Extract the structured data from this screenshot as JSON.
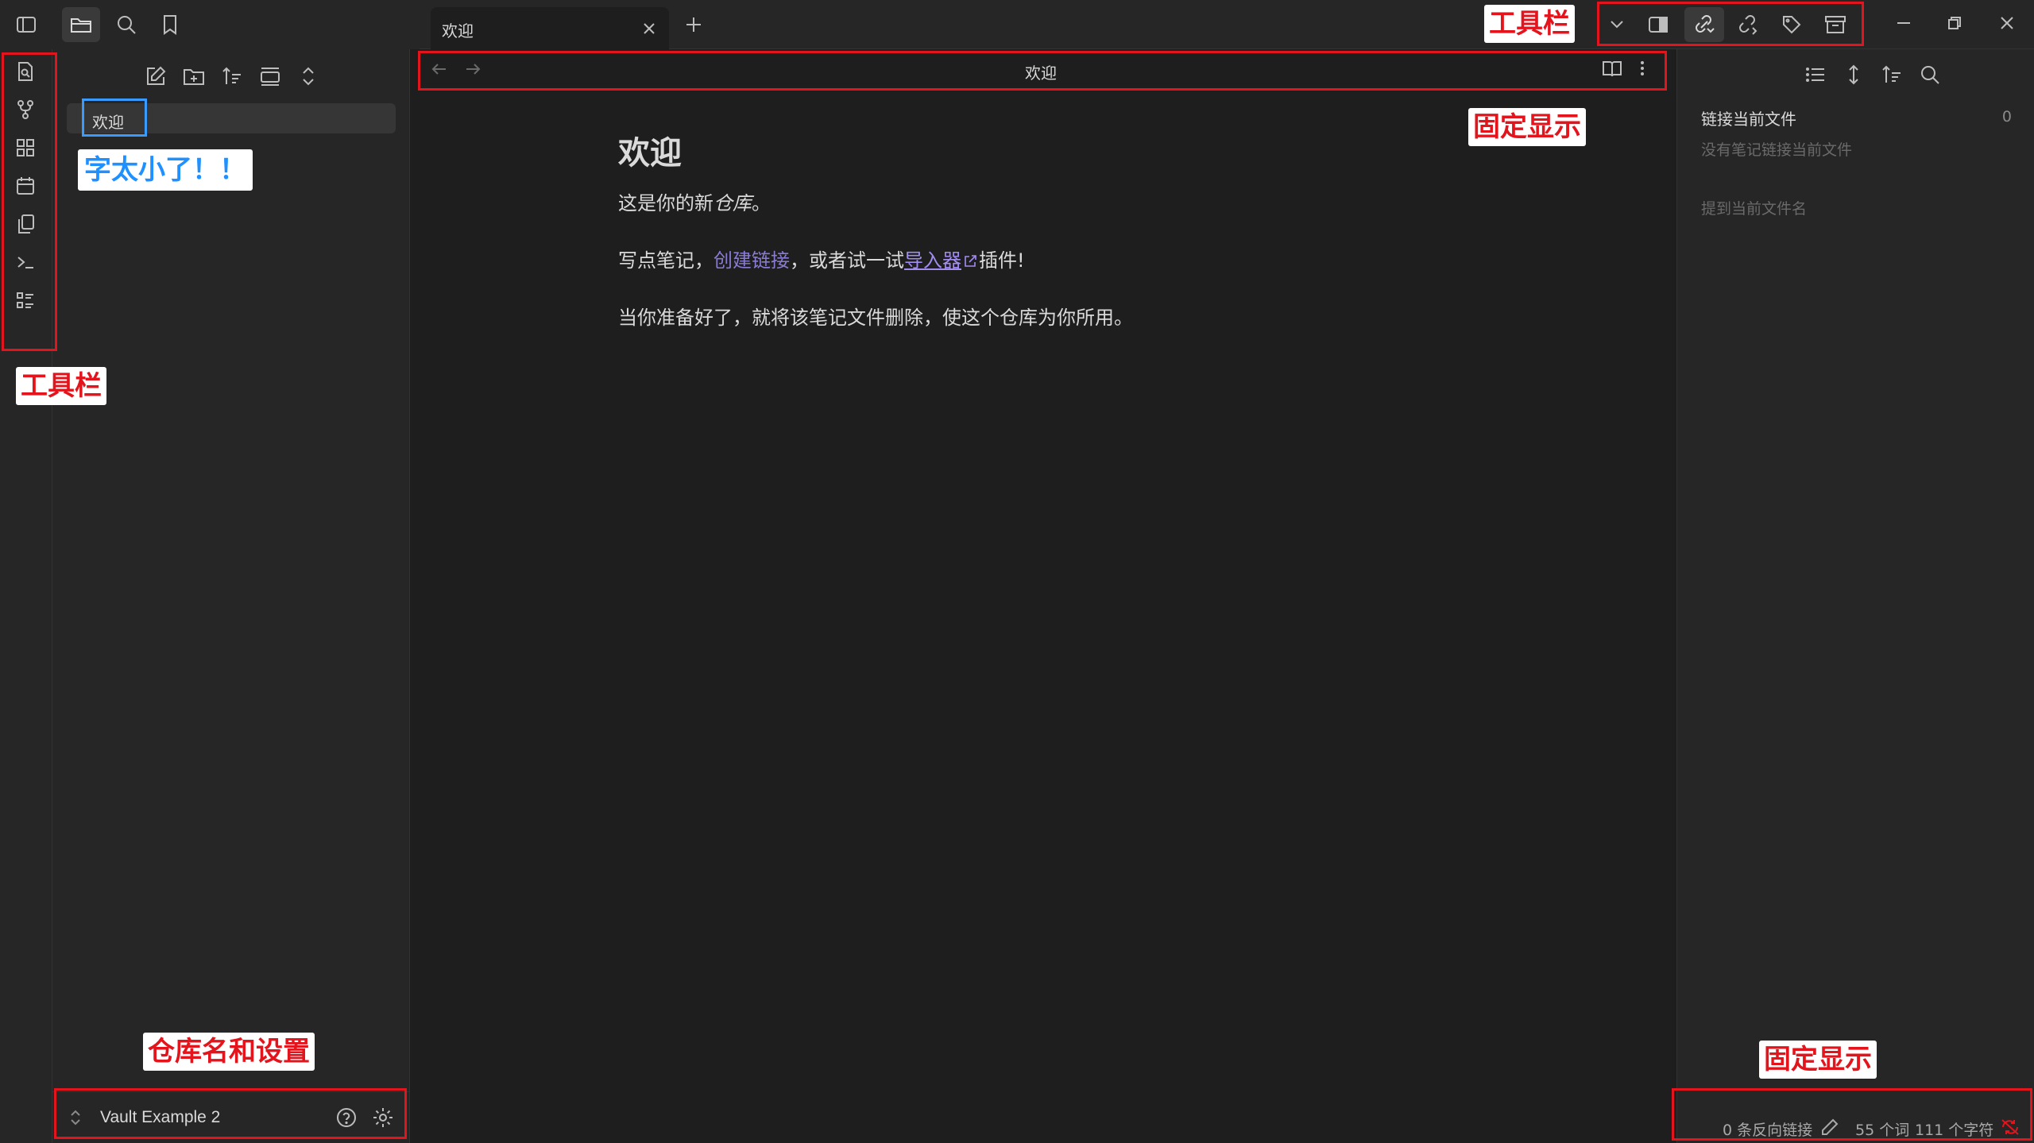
{
  "tab": {
    "title": "欢迎"
  },
  "file_explorer": {
    "items": [
      "欢迎"
    ]
  },
  "view_header": {
    "title": "欢迎"
  },
  "note": {
    "heading": "欢迎",
    "p1_prefix": "这是你的新",
    "p1_italic": "仓库",
    "p1_suffix": "。",
    "p2_prefix": "写点笔记，",
    "p2_link1": "创建链接",
    "p2_mid": "，或者试一试",
    "p2_link2": "导入器",
    "p2_suffix": "插件!",
    "p3": "当你准备好了，就将该笔记文件删除，使这个仓库为你所用。"
  },
  "vault": {
    "name": "Vault Example 2"
  },
  "backlinks": {
    "linked_title": "链接当前文件",
    "linked_count": "0",
    "linked_empty": "没有笔记链接当前文件",
    "unlinked_title": "提到当前文件名"
  },
  "status_bar": {
    "backlinks": "0 条反向链接",
    "words": "55 个词",
    "chars": "111 个字符"
  },
  "annotations": {
    "toolbar_top": "工具栏",
    "fixed_top": "固定显示",
    "font_small": "字太小了！！",
    "toolbar_left": "工具栏",
    "vault_settings": "仓库名和设置",
    "fixed_bottom": "固定显示"
  },
  "colors": {
    "background": "#1e1e1e",
    "sidebar": "#262626",
    "internal_link": "#8a7ad4",
    "external_link": "#a38cf0",
    "annotation_red": "#e3141c",
    "annotation_blue": "#1e90ff"
  }
}
